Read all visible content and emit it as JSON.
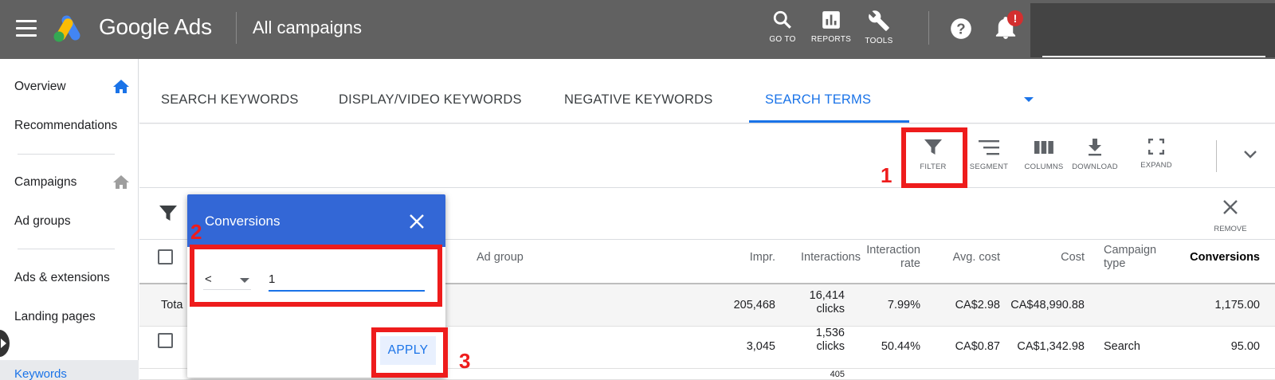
{
  "app": {
    "brand": "Google Ads",
    "page_title": "All campaigns",
    "brand_colors": {
      "blue": "#4285f4",
      "yellow": "#fbbc04",
      "green": "#34a853"
    }
  },
  "topbar": {
    "tools": [
      {
        "label": "GO TO",
        "icon": "search-icon"
      },
      {
        "label": "REPORTS",
        "icon": "reports-icon"
      },
      {
        "label": "TOOLS",
        "icon": "wrench-icon"
      }
    ],
    "notification_badge": "!"
  },
  "sidebar": {
    "items": [
      {
        "label": "Overview",
        "icon": "home-icon"
      },
      {
        "label": "Recommendations"
      },
      {
        "label": "Campaigns",
        "icon": "home-icon"
      },
      {
        "label": "Ad groups"
      },
      {
        "label": "Ads & extensions"
      },
      {
        "label": "Landing pages"
      },
      {
        "label": "Keywords"
      }
    ]
  },
  "tabs": [
    {
      "label": "SEARCH KEYWORDS"
    },
    {
      "label": "DISPLAY/VIDEO KEYWORDS"
    },
    {
      "label": "NEGATIVE KEYWORDS"
    },
    {
      "label": "SEARCH TERMS",
      "active": true
    }
  ],
  "toolbar": {
    "buttons": [
      {
        "label": "FILTER",
        "icon": "filter-icon"
      },
      {
        "label": "SEGMENT",
        "icon": "segment-icon"
      },
      {
        "label": "COLUMNS",
        "icon": "columns-icon"
      },
      {
        "label": "DOWNLOAD",
        "icon": "download-icon"
      },
      {
        "label": "EXPAND",
        "icon": "expand-icon"
      }
    ]
  },
  "filter_row": {
    "remove_label": "REMOVE"
  },
  "table": {
    "headers": {
      "ad_group": "Ad group",
      "impr": "Impr.",
      "interactions": "Interactions",
      "interaction_rate": [
        "Interaction",
        "rate"
      ],
      "avg_cost": "Avg. cost",
      "cost": "Cost",
      "campaign_type": [
        "Campaign",
        "type"
      ],
      "conversions": "Conversions"
    },
    "total": {
      "label": "Tota",
      "impr": "205,468",
      "interactions": [
        "16,414",
        "clicks"
      ],
      "interaction_rate": "7.99%",
      "avg_cost": "CA$2.98",
      "cost": "CA$48,990.88",
      "conversions": "1,175.00"
    },
    "rows": [
      {
        "impr": "3,045",
        "interactions": [
          "1,536",
          "clicks"
        ],
        "interaction_rate": "50.44%",
        "avg_cost": "CA$0.87",
        "cost": "CA$1,342.98",
        "campaign_type": "Search",
        "conversions": "95.00"
      },
      {
        "interactions": [
          "405",
          ""
        ]
      }
    ]
  },
  "filter_dialog": {
    "title": "Conversions",
    "operator": "<",
    "value": "1",
    "apply_label": "APPLY"
  },
  "annotations": {
    "step1": "1",
    "step2": "2",
    "step3": "3",
    "color": "#ee1c1c"
  }
}
